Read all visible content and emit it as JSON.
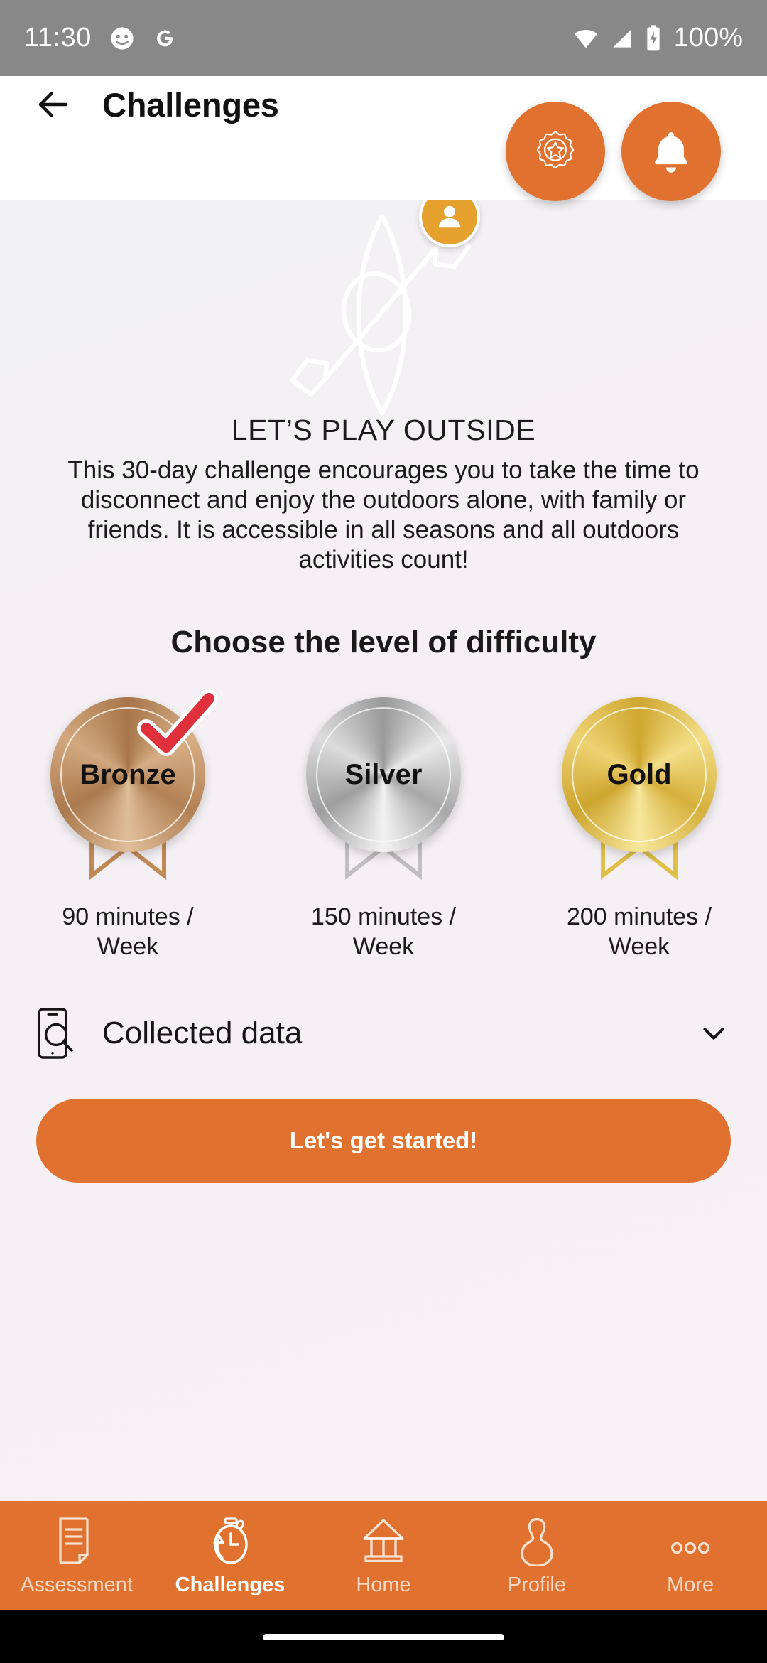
{
  "status_bar": {
    "time": "11:30",
    "battery_percent": "100%",
    "icons": [
      "chat-app-icon",
      "google-icon",
      "wifi-icon",
      "signal-icon",
      "battery-charging-icon"
    ]
  },
  "app_bar": {
    "back_icon": "arrow-left-icon",
    "title": "Challenges"
  },
  "floating_actions": [
    {
      "name": "badge-star-button",
      "icon": "rosette-star-icon",
      "color": "#e0712f"
    },
    {
      "name": "notifications-button",
      "icon": "bell-icon",
      "color": "#e0712f"
    }
  ],
  "hero": {
    "avatar_icon": "person-avatar-icon",
    "avatar_color": "#e6a02e",
    "illustration_icon": "kayak-paddle-icon"
  },
  "challenge": {
    "title": "LET’S PLAY OUTSIDE",
    "description": "This 30-day challenge encourages you to take the time to disconnect and enjoy the outdoors alone, with family or friends. It is accessible in all seasons and all outdoors activities count!"
  },
  "difficulty": {
    "heading": "Choose the level of difficulty",
    "levels": [
      {
        "label": "Bronze",
        "caption": "90 minutes / Week",
        "color": "#b2814f",
        "selected": true
      },
      {
        "label": "Silver",
        "caption": "150 minutes / Week",
        "color": "#b9b9b9",
        "selected": false
      },
      {
        "label": "Gold",
        "caption": "200 minutes / Week",
        "color": "#d9b33c",
        "selected": false
      }
    ],
    "selected_marker_icon": "red-check-icon",
    "selected_marker_color": "#e0303c"
  },
  "collected_data": {
    "icon": "phone-search-icon",
    "label": "Collected data",
    "expand_icon": "chevron-down-icon",
    "expanded": false
  },
  "primary_action": {
    "label": "Let's get started!",
    "color": "#e0712f"
  },
  "bottom_nav": {
    "background": "#e0712f",
    "items": [
      {
        "label": "Assessment",
        "icon": "document-icon",
        "active": false
      },
      {
        "label": "Challenges",
        "icon": "stopwatch-icon",
        "active": true
      },
      {
        "label": "Home",
        "icon": "house-icon",
        "active": false
      },
      {
        "label": "Profile",
        "icon": "person-icon",
        "active": false
      },
      {
        "label": "More",
        "icon": "three-dots-icon",
        "active": false
      }
    ]
  }
}
